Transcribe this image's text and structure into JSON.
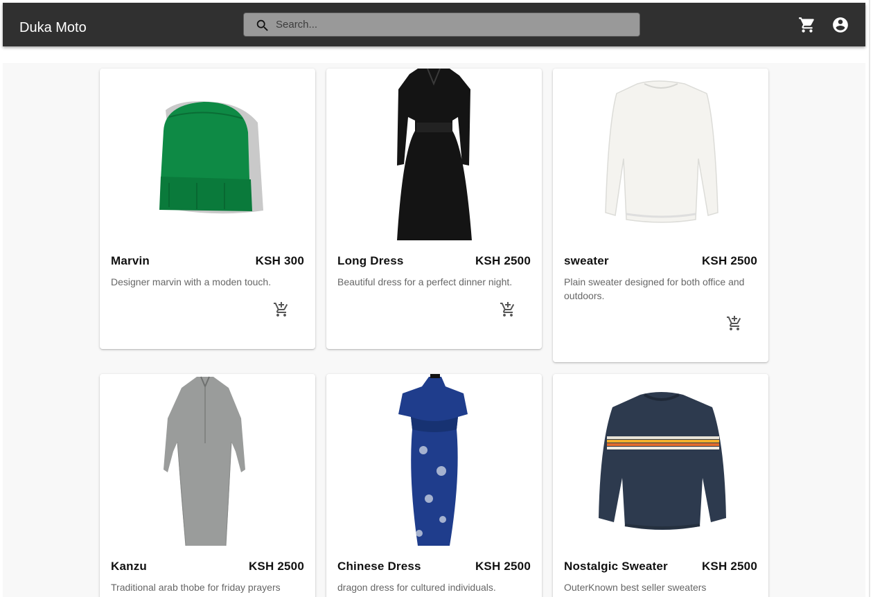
{
  "appbar": {
    "brand": "Duka Moto",
    "search_placeholder": "Search...",
    "cart_icon": "shopping-cart-icon",
    "account_icon": "account-circle-icon"
  },
  "products": [
    {
      "name": "Marvin",
      "price": "KSH 300",
      "description": "Designer marvin with a moden touch.",
      "image": "green-beanie"
    },
    {
      "name": "Long Dress",
      "price": "KSH 2500",
      "description": "Beautiful dress for a perfect dinner night.",
      "image": "black-long-dress"
    },
    {
      "name": "sweater",
      "price": "KSH 2500",
      "description": "Plain sweater designed for both office and outdoors.",
      "image": "white-sweatshirt"
    },
    {
      "name": "Kanzu",
      "price": "KSH 2500",
      "description": "Traditional arab thobe for friday prayers",
      "image": "grey-kanzu"
    },
    {
      "name": "Chinese Dress",
      "price": "KSH 2500",
      "description": "dragon dress for cultured individuals.",
      "image": "blue-qipao"
    },
    {
      "name": "Nostalgic Sweater",
      "price": "KSH 2500",
      "description": "OuterKnown best seller sweaters",
      "image": "navy-striped-sweater"
    }
  ],
  "add_to_cart_icon": "add-shopping-cart-icon",
  "colors": {
    "appbar": "#303030",
    "search_bg": "#999999",
    "background": "#f8f8f8",
    "text_muted": "#666666"
  }
}
